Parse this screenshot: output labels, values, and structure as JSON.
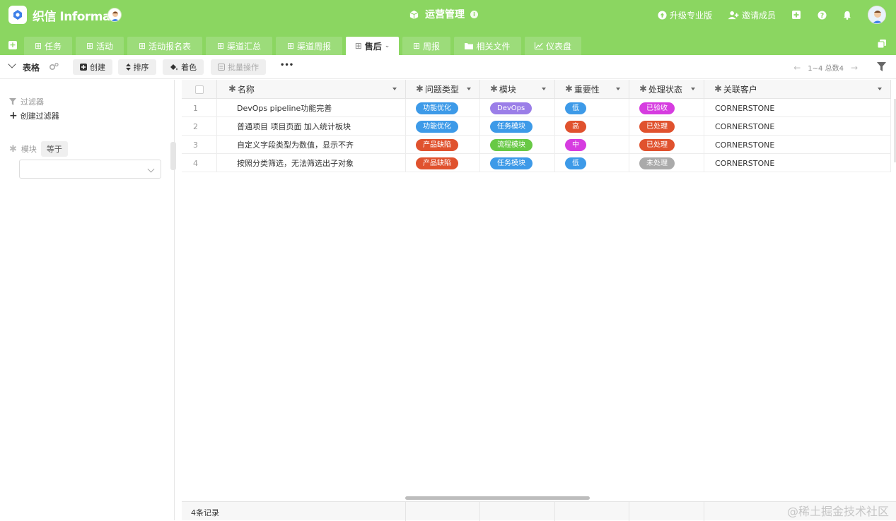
{
  "app": {
    "name": "织信 Informat",
    "title": "运营管理"
  },
  "topbar": {
    "upgrade_label": "升级专业版",
    "invite_label": "邀请成员"
  },
  "tabs": [
    {
      "label": "任务",
      "icon": "table-icon"
    },
    {
      "label": "活动",
      "icon": "table-icon"
    },
    {
      "label": "活动报名表",
      "icon": "table-icon"
    },
    {
      "label": "渠道汇总",
      "icon": "table-icon"
    },
    {
      "label": "渠道周报",
      "icon": "table-icon"
    },
    {
      "label": "售后",
      "icon": "table-icon",
      "active": true
    },
    {
      "label": "周报",
      "icon": "table-icon"
    },
    {
      "label": "相关文件",
      "icon": "folder-icon"
    },
    {
      "label": "仪表盘",
      "icon": "chart-icon"
    }
  ],
  "toolbar": {
    "view_label": "表格",
    "create_label": "创建",
    "sort_label": "排序",
    "color_label": "着色",
    "batch_label": "批量操作",
    "more_label": "•••",
    "pager_text": "1~4 总数4"
  },
  "sidebar": {
    "filter_title": "过滤器",
    "create_filter_label": "创建过滤器",
    "field_label": "模块",
    "operator_label": "等于"
  },
  "grid": {
    "columns": [
      {
        "label": "名称"
      },
      {
        "label": "问题类型"
      },
      {
        "label": "模块"
      },
      {
        "label": "重要性"
      },
      {
        "label": "处理状态"
      },
      {
        "label": "关联客户"
      }
    ],
    "rows": [
      {
        "num": "1",
        "name": "DevOps pipeline功能完善",
        "type": "功能优化",
        "module": "DevOps",
        "priority": "低",
        "status": "已验收",
        "customer": "CORNERSTONE"
      },
      {
        "num": "2",
        "name": "普通项目 项目页面 加入统计板块",
        "type": "功能优化",
        "module": "任务模块",
        "priority": "高",
        "status": "已处理",
        "customer": "CORNERSTONE"
      },
      {
        "num": "3",
        "name": "自定义字段类型为数值，显示不齐",
        "type": "产品缺陷",
        "module": "流程模块",
        "priority": "中",
        "status": "已处理",
        "customer": "CORNERSTONE"
      },
      {
        "num": "4",
        "name": "按照分类筛选，无法筛选出子对象",
        "type": "产品缺陷",
        "module": "任务模块",
        "priority": "低",
        "status": "未处理",
        "customer": "CORNERSTONE"
      }
    ]
  },
  "footer": {
    "count_label": "4条记录"
  },
  "watermark": "@稀土掘金技术社区",
  "colors": {
    "brand_green": "#8bd661",
    "tag_blue": "#3d9ae8",
    "tag_red": "#e0522e",
    "tag_purple": "#9b7ee8",
    "tag_green": "#68c945",
    "tag_magenta": "#d63ce0",
    "tag_gray": "#aaaaaa"
  }
}
